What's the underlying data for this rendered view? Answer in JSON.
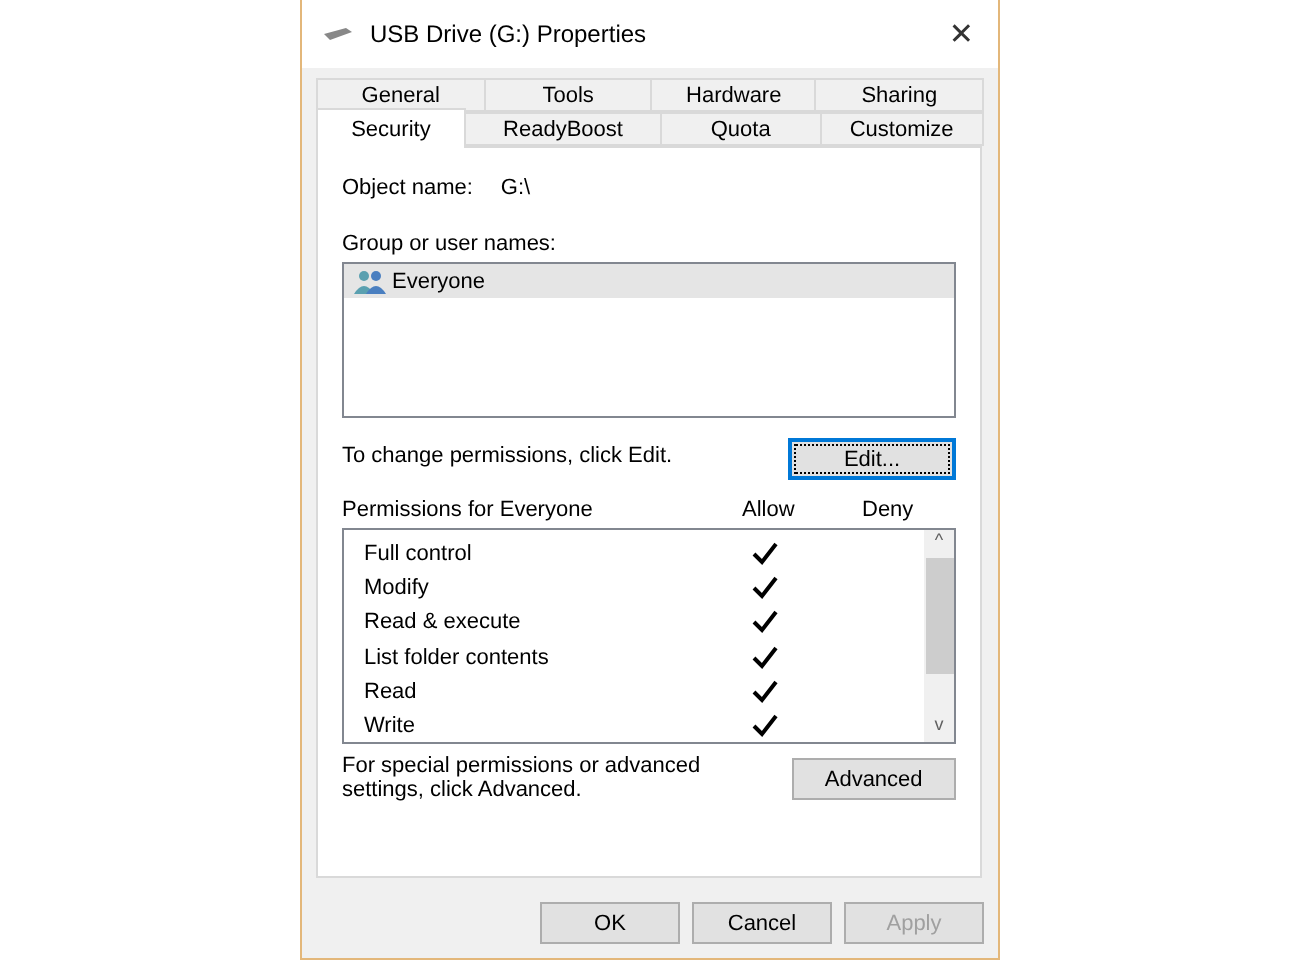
{
  "window": {
    "title": "USB Drive (G:) Properties",
    "close": "✕"
  },
  "tab_rows": [
    [
      {
        "label": "General",
        "selected": false
      },
      {
        "label": "Tools",
        "selected": false
      },
      {
        "label": "Hardware",
        "selected": false
      },
      {
        "label": "Sharing",
        "selected": false
      }
    ],
    [
      {
        "label": "Security",
        "selected": true
      },
      {
        "label": "ReadyBoost",
        "selected": false
      },
      {
        "label": "Quota",
        "selected": false
      },
      {
        "label": "Customize",
        "selected": false
      }
    ]
  ],
  "object_name": {
    "label": "Object name:",
    "value": "G:\\"
  },
  "groups": {
    "label": "Group or user names:",
    "items": [
      {
        "name": "Everyone",
        "selected": true
      }
    ]
  },
  "change_hint": "To change permissions, click Edit.",
  "edit_button": {
    "label": "Edit...",
    "focused": true
  },
  "permissions": {
    "label": "Permissions for Everyone",
    "allow_header": "Allow",
    "deny_header": "Deny",
    "scroll_up": "^",
    "scroll_down": "v",
    "rows": [
      {
        "name": "Full control",
        "allow": true,
        "deny": false
      },
      {
        "name": "Modify",
        "allow": true,
        "deny": false
      },
      {
        "name": "Read & execute",
        "allow": true,
        "deny": false
      },
      {
        "name": "List folder contents",
        "allow": true,
        "deny": false
      },
      {
        "name": "Read",
        "allow": true,
        "deny": false
      },
      {
        "name": "Write",
        "allow": true,
        "deny": false
      }
    ]
  },
  "advanced_hint": "For special permissions or advanced settings, click Advanced.",
  "advanced_button": {
    "label": "Advanced"
  },
  "buttons": [
    {
      "label": "OK",
      "disabled": false
    },
    {
      "label": "Cancel",
      "disabled": false
    },
    {
      "label": "Apply",
      "disabled": true
    }
  ]
}
